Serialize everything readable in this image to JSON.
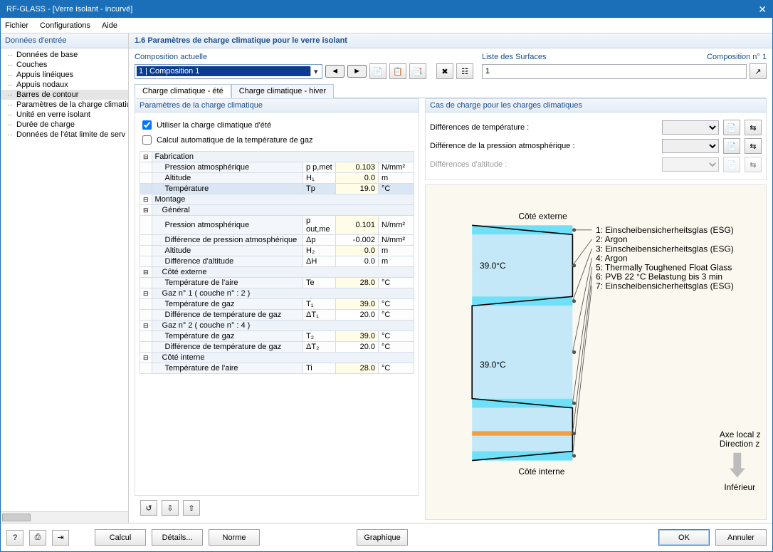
{
  "title": "RF-GLASS - [Verre isolant - incurvé]",
  "menus": [
    "Fichier",
    "Configurations",
    "Aide"
  ],
  "sidebar_head": "Données d'entrée",
  "tree": [
    "Données de base",
    "Couches",
    "Appuis linéiques",
    "Appuis nodaux",
    "Barres de contour",
    "Paramètres de la charge climatiq",
    "Unité en verre isolant",
    "Durée de charge",
    "Données de l'état limite de serv"
  ],
  "tree_selected": 4,
  "main_head": "1.6 Paramètres de charge climatique pour le verre isolant",
  "composition": {
    "label": "Composition actuelle",
    "value": "1 | Composition 1"
  },
  "surfaces": {
    "label": "Liste des Surfaces",
    "right_label": "Composition n° 1",
    "value": "1"
  },
  "tabs": [
    "Charge climatique - été",
    "Charge climatique - hiver"
  ],
  "active_tab": 0,
  "params_head": "Paramètres de la charge climatique",
  "chk1": "Utiliser la charge climatique d'été",
  "chk2": "Calcul automatique de la température de gaz",
  "rows": [
    {
      "t": "grp",
      "lbl": "Fabrication"
    },
    {
      "t": "val",
      "lbl": "Pression atmosphérique",
      "sym": "p p,met",
      "val": "0.103",
      "unit": "N/mm²",
      "ed": true
    },
    {
      "t": "val",
      "lbl": "Altitude",
      "sym": "H₁",
      "val": "0.0",
      "unit": "m",
      "ed": true
    },
    {
      "t": "val",
      "lbl": "Température",
      "sym": "Tp",
      "val": "19.0",
      "unit": "°C",
      "ed": true,
      "sel": true
    },
    {
      "t": "grp",
      "lbl": "Montage"
    },
    {
      "t": "sub",
      "lbl": "Général"
    },
    {
      "t": "val",
      "lbl": "Pression atmosphérique",
      "sym": "p out,me",
      "val": "0.101",
      "unit": "N/mm²",
      "ed": true
    },
    {
      "t": "val",
      "lbl": "Différence de pression atmosphérique",
      "sym": "Δp",
      "val": "-0.002",
      "unit": "N/mm²"
    },
    {
      "t": "val",
      "lbl": "Altitude",
      "sym": "H₂",
      "val": "0.0",
      "unit": "m",
      "ed": true
    },
    {
      "t": "val",
      "lbl": "Différence d'altitude",
      "sym": "ΔH",
      "val": "0.0",
      "unit": "m"
    },
    {
      "t": "sub",
      "lbl": "Côté externe"
    },
    {
      "t": "val",
      "lbl": "Température de l'aire",
      "sym": "Te",
      "val": "28.0",
      "unit": "°C",
      "ed": true
    },
    {
      "t": "sub",
      "lbl": "Gaz n° 1 ( couche n° : 2 )"
    },
    {
      "t": "val",
      "lbl": "Température de gaz",
      "sym": "T₁",
      "val": "39.0",
      "unit": "°C",
      "ed": true
    },
    {
      "t": "val",
      "lbl": "Différence de température de gaz",
      "sym": "ΔT₁",
      "val": "20.0",
      "unit": "°C"
    },
    {
      "t": "sub",
      "lbl": "Gaz n° 2 ( couche n° : 4 )"
    },
    {
      "t": "val",
      "lbl": "Température de gaz",
      "sym": "T₂",
      "val": "39.0",
      "unit": "°C",
      "ed": true
    },
    {
      "t": "val",
      "lbl": "Différence de température de gaz",
      "sym": "ΔT₂",
      "val": "20.0",
      "unit": "°C"
    },
    {
      "t": "sub",
      "lbl": "Côté interne"
    },
    {
      "t": "val",
      "lbl": "Température de l'aire",
      "sym": "Ti",
      "val": "28.0",
      "unit": "°C",
      "ed": true
    }
  ],
  "loadcase_head": "Cas de charge pour les charges climatiques",
  "loadcases": [
    {
      "lbl": "Différences de température :",
      "disabled": false
    },
    {
      "lbl": "Différence de la pression atmosphérique :",
      "disabled": false
    },
    {
      "lbl": "Différences d'altitude :",
      "disabled": true
    }
  ],
  "diagram": {
    "top": "Côté externe",
    "bottom": "Côté interne",
    "temp1": "39.0°C",
    "temp2": "39.0°C",
    "legend": [
      "1: Einscheibensicherheitsglas (ESG)",
      "2: Argon",
      "3: Einscheibensicherheitsglas (ESG)",
      "4: Argon",
      "5: Thermally Toughened Float Glass",
      "6: PVB 22 °C Belastung bis 3 min",
      "7: Einscheibensicherheitsglas (ESG)"
    ],
    "axis1": "Axe local z",
    "axis2": "Direction z",
    "axis3": "Inférieur"
  },
  "footer": {
    "calcul": "Calcul",
    "details": "Détails...",
    "norme": "Norme",
    "graphique": "Graphique",
    "ok": "OK",
    "annuler": "Annuler"
  }
}
